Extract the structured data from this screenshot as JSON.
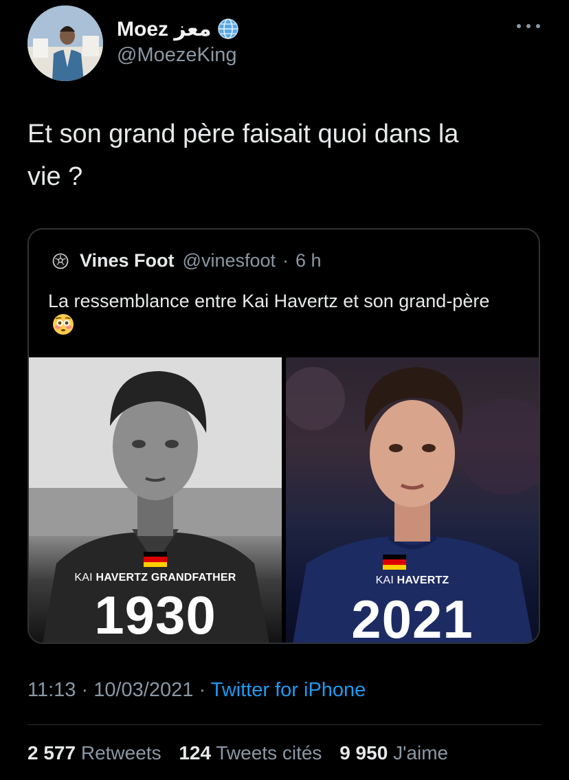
{
  "author": {
    "display_name": "Moez معز",
    "handle": "@MoezeKing",
    "badge_icon": "globe-icon"
  },
  "tweet": {
    "text": "Et son grand père faisait quoi dans la\nvie ?"
  },
  "quoted_tweet": {
    "name": "Vines Foot",
    "handle": "@vinesfoot",
    "separator": "·",
    "time": "6 h",
    "avatar_icon": "soccer-ball-icon",
    "text": "La ressemblance entre Kai Havertz et son grand-père",
    "emoji": "flushed-face-emoji",
    "media": {
      "left": {
        "caption_prefix": "KAI",
        "caption_bold": "HAVERTZ GRANDFATHER",
        "year": "1930",
        "flag": "german-flag-icon"
      },
      "right": {
        "caption_prefix": "KAI",
        "caption_bold": "HAVERTZ",
        "year": "2021",
        "flag": "german-flag-icon"
      }
    }
  },
  "meta": {
    "time": "11:13",
    "date": "10/03/2021",
    "separator": "·",
    "source": "Twitter for iPhone"
  },
  "stats": {
    "retweets_count": "2 577",
    "retweets_label": "Retweets",
    "quotes_count": "124",
    "quotes_label": "Tweets cités",
    "likes_count": "9 950",
    "likes_label": "J'aime"
  },
  "colors": {
    "background": "#000000",
    "link": "#1d9bf0",
    "secondary_text": "#8b98a5",
    "border": "#2f3336"
  }
}
